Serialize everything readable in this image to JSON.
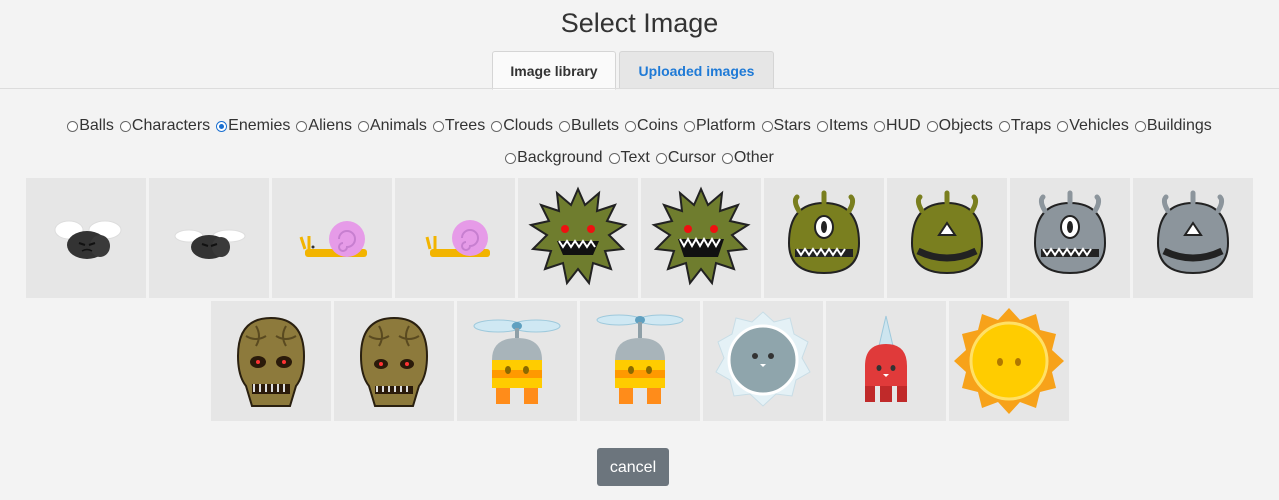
{
  "dialog": {
    "title": "Select Image"
  },
  "tabs": [
    {
      "label": "Image library",
      "active": true
    },
    {
      "label": "Uploaded images",
      "active": false
    }
  ],
  "categories_row1": [
    "Balls",
    "Characters",
    "Enemies",
    "Aliens",
    "Animals",
    "Trees",
    "Clouds",
    "Bullets",
    "Coins",
    "Platform",
    "Stars",
    "Items",
    "HUD",
    "Objects",
    "Traps",
    "Vehicles",
    "Buildings"
  ],
  "categories_row2": [
    "Background",
    "Text",
    "Cursor",
    "Other"
  ],
  "selected_category": "Enemies",
  "images_row1": [
    "fly-enemy-icon",
    "fly-enemy-alt-icon",
    "snail-enemy-icon",
    "snail-enemy-alt-icon",
    "spiky-green-monster-icon",
    "spiky-green-monster-alt-icon",
    "green-eye-monster-icon",
    "green-eye-monster-alt-icon",
    "gray-eye-monster-icon",
    "gray-eye-monster-alt-icon"
  ],
  "images_row2": [
    "brown-skull-monster-icon",
    "brown-skull-monster-alt-icon",
    "propeller-robot-icon",
    "propeller-robot-alt-icon",
    "frost-ball-enemy-icon",
    "red-spike-enemy-icon",
    "sun-enemy-icon"
  ],
  "footer": {
    "cancel_label": "cancel"
  },
  "colors": {
    "accent": "#1a6fd0",
    "tab_link": "#1f7ad6",
    "cancel_bg": "#6c757d"
  }
}
